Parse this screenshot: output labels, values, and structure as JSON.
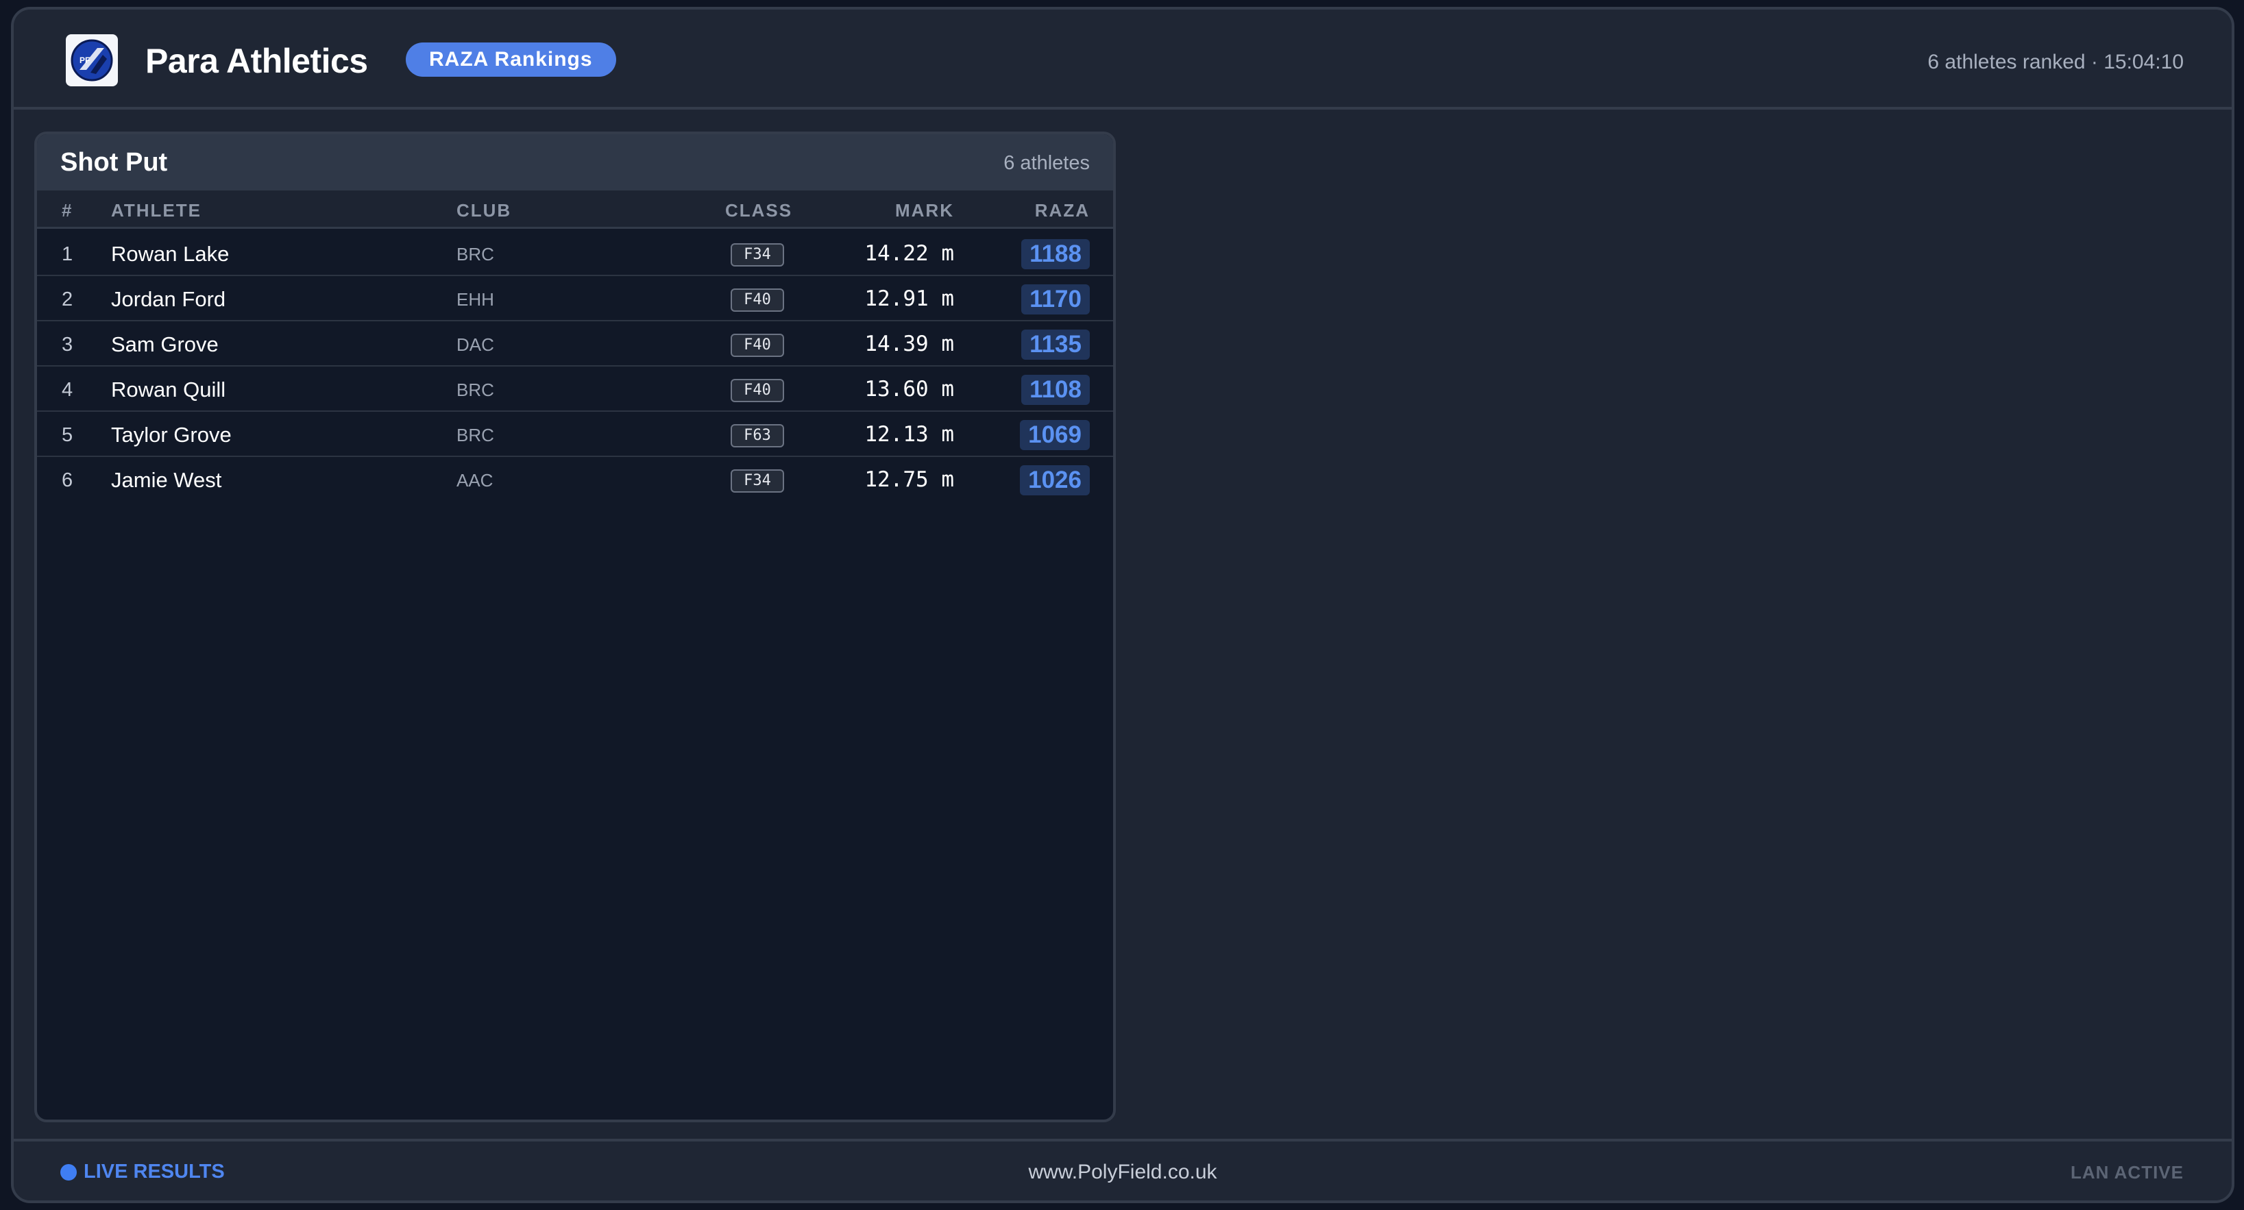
{
  "header": {
    "app_title": "Para Athletics",
    "badge_label": "RAZA Rankings",
    "status": "6 athletes ranked · 15:04:10",
    "logo_icon": "polyfield-logo-icon"
  },
  "panel": {
    "title": "Shot Put",
    "count": "6 athletes",
    "columns": {
      "rank": "#",
      "athlete": "ATHLETE",
      "club": "CLUB",
      "class": "CLASS",
      "mark": "MARK",
      "raza": "RAZA"
    },
    "rows": [
      {
        "rank": "1",
        "athlete": "Rowan Lake",
        "club": "BRC",
        "class": "F34",
        "mark": "14.22 m",
        "raza": "1188"
      },
      {
        "rank": "2",
        "athlete": "Jordan Ford",
        "club": "EHH",
        "class": "F40",
        "mark": "12.91 m",
        "raza": "1170"
      },
      {
        "rank": "3",
        "athlete": "Sam Grove",
        "club": "DAC",
        "class": "F40",
        "mark": "14.39 m",
        "raza": "1135"
      },
      {
        "rank": "4",
        "athlete": "Rowan Quill",
        "club": "BRC",
        "class": "F40",
        "mark": "13.60 m",
        "raza": "1108"
      },
      {
        "rank": "5",
        "athlete": "Taylor Grove",
        "club": "BRC",
        "class": "F63",
        "mark": "12.13 m",
        "raza": "1069"
      },
      {
        "rank": "6",
        "athlete": "Jamie West",
        "club": "AAC",
        "class": "F34",
        "mark": "12.75 m",
        "raza": "1026"
      }
    ]
  },
  "footer": {
    "live_label": "LIVE RESULTS",
    "site": "www.PolyField.co.uk",
    "lan_status": "LAN ACTIVE"
  },
  "colors": {
    "accent": "#4f7fe6",
    "background": "#1e2533",
    "panel": "#111827"
  }
}
